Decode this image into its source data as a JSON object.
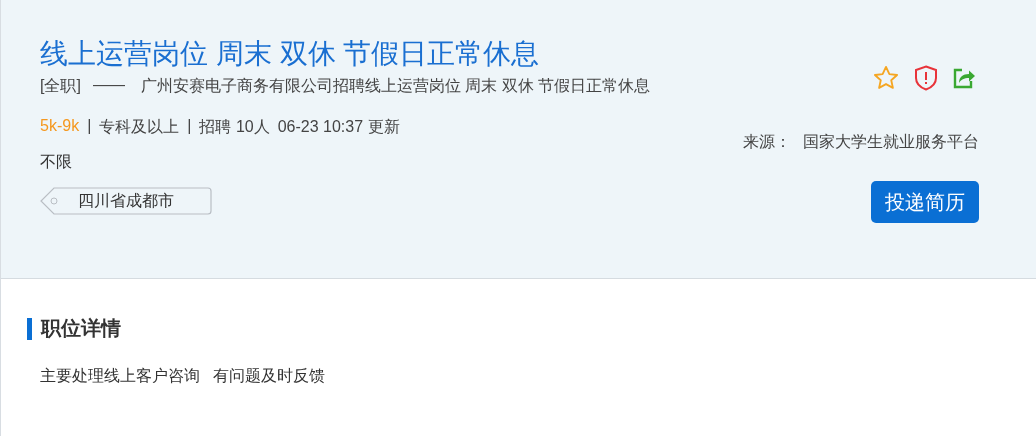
{
  "job": {
    "title": "线上运营岗位 周末 双休 节假日正常休息",
    "employment_type": "[全职]",
    "dash": "——",
    "company_line": "广州安赛电子商务有限公司招聘线上运营岗位 周末 双休 节假日正常休息",
    "meta": [
      {
        "kind": "salary",
        "text": "5k-9k"
      },
      {
        "kind": "separator",
        "text": "|"
      },
      {
        "kind": "plain",
        "text": "专科及以上"
      },
      {
        "kind": "separator",
        "text": "|"
      },
      {
        "kind": "plain",
        "text": "招聘 10人"
      },
      {
        "kind": "plain",
        "text": "06-23 10:37 更新"
      }
    ],
    "requirement": "不限",
    "location": "四川省成都市",
    "source_label": "来源：",
    "source": "国家大学生就业服务平台",
    "apply_button": "投递简历"
  },
  "details": {
    "heading": "职位详情",
    "description": "主要处理线上客户咨询   有问题及时反馈"
  }
}
